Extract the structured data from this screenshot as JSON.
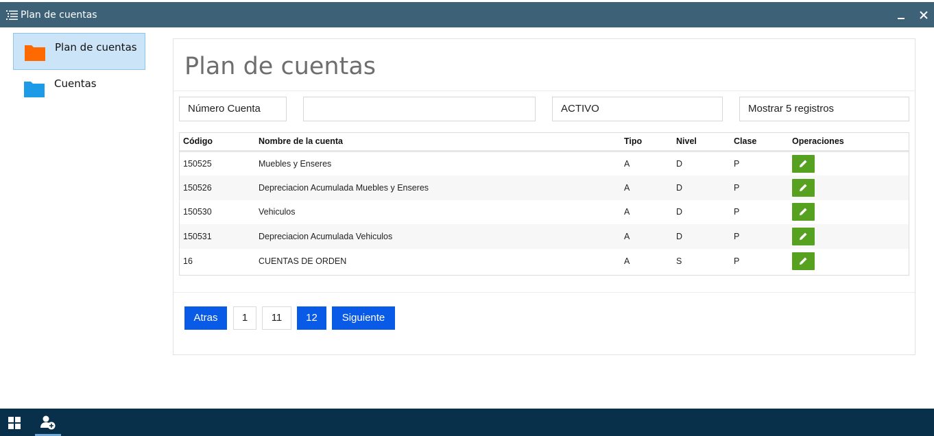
{
  "window": {
    "title": "Plan de cuentas"
  },
  "sidebar": {
    "items": [
      {
        "label": "Plan de cuentas",
        "icon": "folder-icon",
        "color": "#ff6a00",
        "active": true
      },
      {
        "label": "Cuentas",
        "icon": "folder-icon",
        "color": "#1e9be6",
        "active": false
      }
    ]
  },
  "main": {
    "title": "Plan de cuentas",
    "filters": {
      "account_number_label": "Número Cuenta",
      "search_value": "",
      "type_value": "ACTIVO",
      "page_size_value": "Mostrar 5 registros"
    },
    "table": {
      "headers": [
        "Código",
        "Nombre de la cuenta",
        "Tipo",
        "Nivel",
        "Clase",
        "Operaciones"
      ],
      "rows": [
        [
          "150525",
          "Muebles y Enseres",
          "A",
          "D",
          "P"
        ],
        [
          "150526",
          "Depreciacion Acumulada Muebles y Enseres",
          "A",
          "D",
          "P"
        ],
        [
          "150530",
          "Vehiculos",
          "A",
          "D",
          "P"
        ],
        [
          "150531",
          "Depreciacion Acumulada Vehiculos",
          "A",
          "D",
          "P"
        ],
        [
          "16",
          "CUENTAS DE ORDEN",
          "A",
          "S",
          "P"
        ]
      ],
      "edit_icon": "pencil-icon"
    },
    "pagination": {
      "prev_label": "Atras",
      "pages": [
        "1",
        "11",
        "12"
      ],
      "current_page": "12",
      "next_label": "Siguiente"
    }
  },
  "colors": {
    "titlebar": "#3d6177",
    "taskbar": "#09304a",
    "primary_button": "#0a5ae8",
    "edit_button": "#57a121",
    "active_sidebar": "#cce4f7"
  }
}
